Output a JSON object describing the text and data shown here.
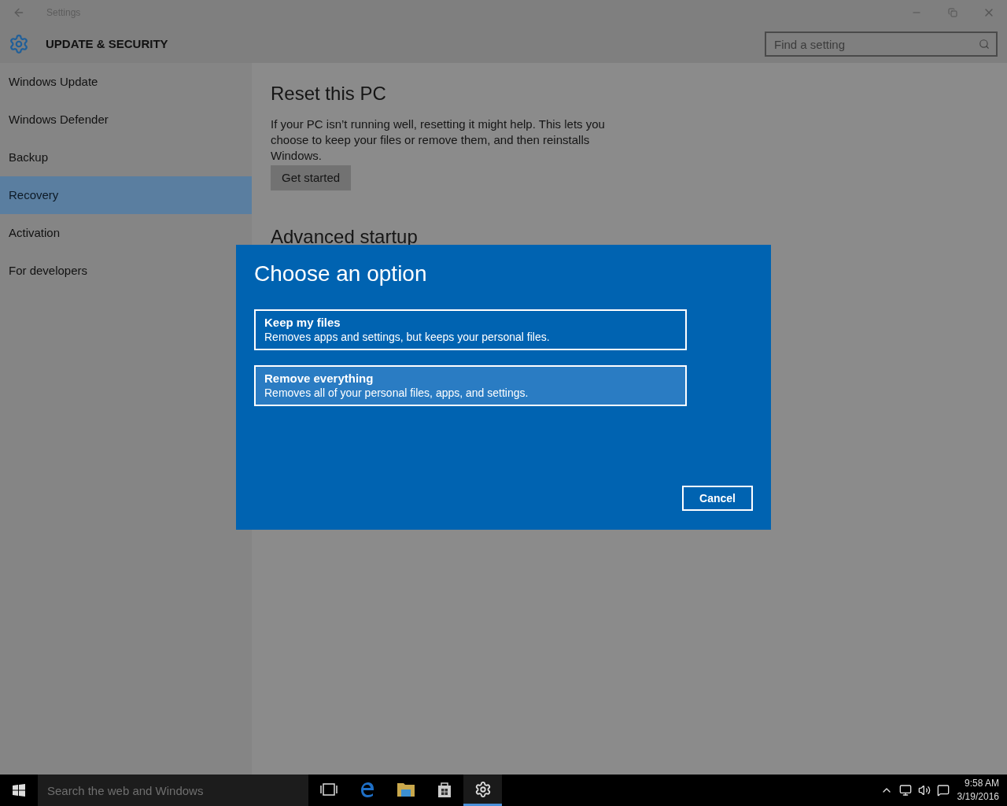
{
  "window": {
    "title": "Settings"
  },
  "header": {
    "title": "UPDATE & SECURITY",
    "search": {
      "placeholder": "Find a setting"
    }
  },
  "sidebar": {
    "items": [
      {
        "label": "Windows Update",
        "selected": false
      },
      {
        "label": "Windows Defender",
        "selected": false
      },
      {
        "label": "Backup",
        "selected": false
      },
      {
        "label": "Recovery",
        "selected": true
      },
      {
        "label": "Activation",
        "selected": false
      },
      {
        "label": "For developers",
        "selected": false
      }
    ]
  },
  "content": {
    "sections": [
      {
        "heading": "Reset this PC",
        "text": "If your PC isn’t running well, resetting it might help. This lets you choose to keep your files or remove them, and then reinstalls Windows.",
        "button": "Get started"
      },
      {
        "heading": "Advanced startup"
      }
    ]
  },
  "dialog": {
    "title": "Choose an option",
    "options": [
      {
        "title": "Keep my files",
        "description": "Removes apps and settings, but keeps your personal files.",
        "selected": false
      },
      {
        "title": "Remove everything",
        "description": "Removes all of your personal files, apps, and settings.",
        "selected": true
      }
    ],
    "button": "Cancel"
  },
  "taskbar": {
    "search": {
      "placeholder": "Search the web and Windows"
    },
    "apps": [
      {
        "kind": "task-view",
        "active": false
      },
      {
        "kind": "browser",
        "active": false
      },
      {
        "kind": "folder",
        "active": false
      },
      {
        "kind": "store",
        "active": false
      },
      {
        "kind": "settings",
        "active": true
      }
    ],
    "clock": {
      "time": "9:58 AM",
      "date": "3/19/2016"
    }
  }
}
